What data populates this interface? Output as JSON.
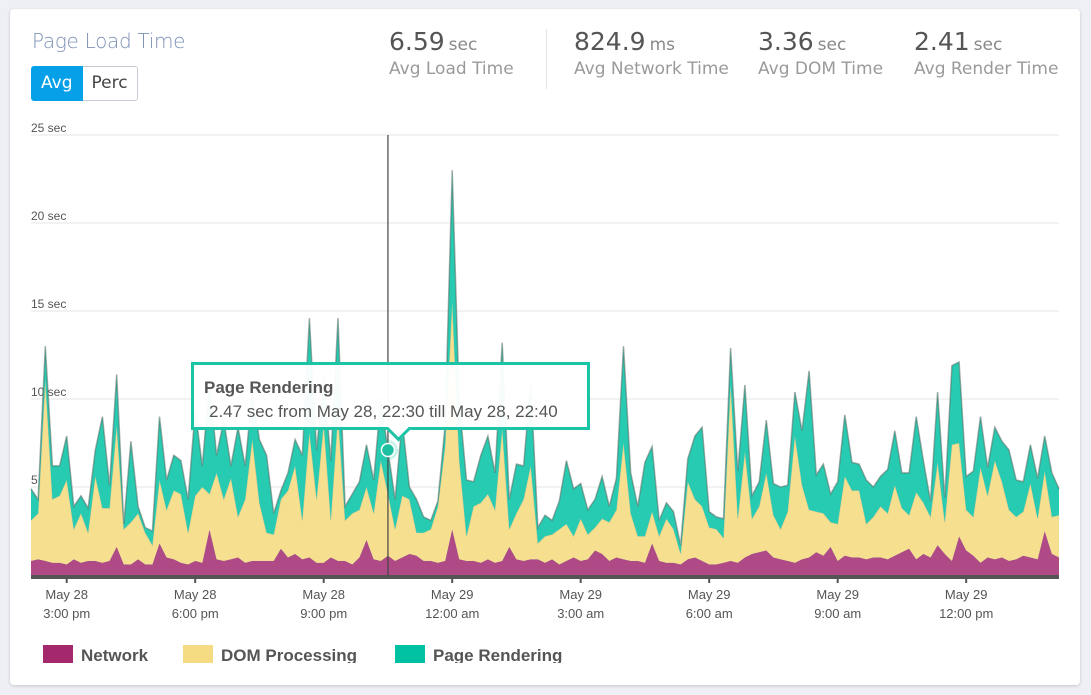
{
  "header": {
    "title": "Page Load Time",
    "toggle": [
      {
        "label": "Avg",
        "active": true
      },
      {
        "label": "Perc",
        "active": false
      }
    ]
  },
  "stats": [
    {
      "value": "6.59",
      "unit": "sec",
      "label": "Avg Load Time"
    },
    {
      "value": "824.9",
      "unit": "ms",
      "label": "Avg Network Time"
    },
    {
      "value": "3.36",
      "unit": "sec",
      "label": "Avg DOM Time"
    },
    {
      "value": "2.41",
      "unit": "sec",
      "label": "Avg Render Time"
    }
  ],
  "tooltip": {
    "title": "Page Rendering",
    "text": "2.47 sec from May 28, 22:30 till May 28, 22:40",
    "time": "May 28, 22:30"
  },
  "chart_data": {
    "type": "area",
    "stacked": true,
    "x_start": "May 28, 14:10",
    "x_step_minutes": 10,
    "ylim": [
      0,
      25
    ],
    "yticks": [
      {
        "value": 5,
        "label": "5 sec"
      },
      {
        "value": 10,
        "label": "10 sec"
      },
      {
        "value": 15,
        "label": "15 sec"
      },
      {
        "value": 20,
        "label": "20 sec"
      },
      {
        "value": 25,
        "label": "25 sec"
      }
    ],
    "xticks": [
      {
        "time": "May 28, 15:00",
        "line1": "May 28",
        "line2": "3:00 pm"
      },
      {
        "time": "May 28, 18:00",
        "line1": "May 28",
        "line2": "6:00 pm"
      },
      {
        "time": "May 28, 21:00",
        "line1": "May 28",
        "line2": "9:00 pm"
      },
      {
        "time": "May 29, 00:00",
        "line1": "May 29",
        "line2": "12:00 am"
      },
      {
        "time": "May 29, 03:00",
        "line1": "May 29",
        "line2": "3:00 am"
      },
      {
        "time": "May 29, 06:00",
        "line1": "May 29",
        "line2": "6:00 am"
      },
      {
        "time": "May 29, 09:00",
        "line1": "May 29",
        "line2": "9:00 am"
      },
      {
        "time": "May 29, 12:00",
        "line1": "May 29",
        "line2": "12:00 pm"
      }
    ],
    "grid": true,
    "legend_position": "bottom-left",
    "series": [
      {
        "name": "Network",
        "color": "#a3296c",
        "fill": "#b04a86",
        "values": [
          0.8,
          0.9,
          0.8,
          0.7,
          0.7,
          0.6,
          0.9,
          0.7,
          0.8,
          0.8,
          0.7,
          0.8,
          1.6,
          0.6,
          0.6,
          0.9,
          0.6,
          0.6,
          1.8,
          1.0,
          0.9,
          0.7,
          0.6,
          0.8,
          0.7,
          2.6,
          0.9,
          0.8,
          0.9,
          1.0,
          0.7,
          0.8,
          0.8,
          0.8,
          0.8,
          1.5,
          1.0,
          1.2,
          0.9,
          1.0,
          0.7,
          0.7,
          1.0,
          0.8,
          0.8,
          0.6,
          1.0,
          2.0,
          0.9,
          0.8,
          1.1,
          0.8,
          1.0,
          1.2,
          1.1,
          0.8,
          0.8,
          0.7,
          0.8,
          2.6,
          0.9,
          0.8,
          0.8,
          0.7,
          0.9,
          0.7,
          0.8,
          1.6,
          0.9,
          0.8,
          0.9,
          0.9,
          0.7,
          0.9,
          0.6,
          0.8,
          1.0,
          0.8,
          0.9,
          1.4,
          1.2,
          0.8,
          1.0,
          0.9,
          0.8,
          0.8,
          0.7,
          1.8,
          0.8,
          0.7,
          0.7,
          0.6,
          0.9,
          1.0,
          0.8,
          0.6,
          0.6,
          0.7,
          0.8,
          0.7,
          1.0,
          1.2,
          1.3,
          1.4,
          1.0,
          0.9,
          0.8,
          0.7,
          0.9,
          1.0,
          1.3,
          1.1,
          1.6,
          0.8,
          1.1,
          1.0,
          1.0,
          0.9,
          1.0,
          1.0,
          0.9,
          1.1,
          1.3,
          1.5,
          0.9,
          1.2,
          1.0,
          1.7,
          1.2,
          0.8,
          2.2,
          1.4,
          1.1,
          0.7,
          1.0,
          0.9,
          1.0,
          0.8,
          0.9,
          1.1,
          1.0,
          0.9,
          2.5,
          1.2,
          1.0
        ]
      },
      {
        "name": "DOM Processing",
        "color": "#f5dc82",
        "fill": "#f6e08f",
        "values": [
          2.3,
          2.6,
          10.3,
          3.6,
          3.8,
          4.8,
          1.7,
          2.8,
          1.6,
          4.8,
          3.1,
          3.0,
          6.9,
          2.0,
          2.4,
          2.6,
          1.8,
          1.1,
          3.6,
          2.7,
          3.9,
          3.9,
          1.8,
          3.7,
          4.3,
          2.0,
          4.9,
          3.5,
          4.6,
          2.3,
          3.6,
          6.9,
          3.3,
          1.6,
          1.5,
          2.8,
          3.8,
          5.0,
          2.2,
          7.1,
          3.6,
          7.9,
          2.1,
          8.3,
          2.3,
          2.9,
          2.7,
          3.0,
          2.6,
          5.7,
          3.53,
          1.8,
          3.5,
          3.1,
          1.3,
          1.6,
          1.8,
          3.2,
          6.5,
          12.9,
          5.6,
          1.4,
          3.1,
          3.4,
          3.7,
          3.0,
          7.5,
          1.0,
          2.6,
          3.5,
          5.3,
          0.9,
          1.5,
          1.4,
          2.0,
          2.1,
          1.2,
          2.4,
          1.4,
          1.3,
          2.0,
          2.2,
          2.7,
          6.6,
          2.7,
          1.4,
          1.5,
          1.8,
          1.4,
          2.5,
          1.9,
          0.6,
          4.4,
          3.3,
          3.1,
          2.1,
          2.0,
          1.4,
          10.0,
          2.5,
          6.0,
          2.0,
          2.6,
          4.4,
          2.4,
          1.7,
          2.8,
          7.2,
          4.2,
          2.7,
          2.3,
          2.4,
          1.4,
          2.1,
          4.5,
          3.8,
          3.8,
          2.0,
          2.3,
          2.9,
          2.6,
          4.0,
          2.5,
          1.9,
          3.8,
          2.9,
          2.3,
          4.7,
          1.8,
          6.6,
          5.3,
          2.3,
          2.2,
          5.4,
          3.5,
          5.6,
          4.3,
          2.9,
          2.4,
          2.5,
          4.2,
          2.3,
          3.4,
          2.1,
          2.4
        ]
      },
      {
        "name": "Page Rendering",
        "color": "#00c2a3",
        "fill": "#26cbb1",
        "values": [
          1.8,
          0.8,
          1.9,
          1.9,
          1.7,
          2.5,
          1.3,
          1.0,
          1.4,
          1.5,
          5.2,
          1.3,
          2.9,
          0.3,
          4.6,
          0.4,
          0.3,
          0.8,
          3.6,
          1.7,
          2.0,
          1.9,
          1.9,
          4.9,
          1.2,
          6.4,
          1.0,
          4.5,
          0.7,
          5.1,
          1.9,
          2.8,
          3.6,
          4.4,
          1.2,
          0.5,
          1.0,
          1.5,
          3.7,
          6.5,
          2.8,
          2.7,
          3.4,
          5.5,
          0.8,
          1.1,
          1.6,
          2.4,
          1.9,
          3.5,
          2.47,
          1.7,
          4.3,
          0.7,
          1.9,
          0.9,
          0.5,
          0.3,
          1.2,
          7.5,
          3.3,
          3.2,
          1.4,
          2.7,
          3.3,
          2.1,
          4.9,
          1.7,
          2.8,
          1.9,
          4.8,
          0.9,
          1.2,
          0.8,
          1.6,
          3.6,
          2.7,
          2.0,
          1.4,
          1.6,
          2.4,
          0.9,
          1.8,
          5.5,
          2.3,
          1.7,
          4.2,
          3.7,
          0.9,
          0.9,
          1.0,
          0.5,
          1.3,
          3.6,
          4.5,
          0.9,
          0.7,
          1.1,
          2.1,
          2.7,
          3.8,
          1.3,
          1.4,
          3.0,
          1.8,
          2.4,
          1.5,
          2.5,
          3.1,
          7.9,
          2.1,
          2.8,
          1.6,
          2.4,
          3.5,
          1.6,
          1.5,
          2.5,
          1.7,
          1.7,
          2.5,
          3.1,
          2.0,
          2.4,
          4.3,
          2.4,
          0.9,
          4.0,
          1.4,
          4.5,
          4.6,
          1.9,
          2.6,
          2.9,
          1.6,
          1.9,
          2.3,
          3.4,
          2.1,
          1.7,
          2.2,
          2.3,
          2.0,
          2.5,
          1.5
        ]
      }
    ]
  }
}
